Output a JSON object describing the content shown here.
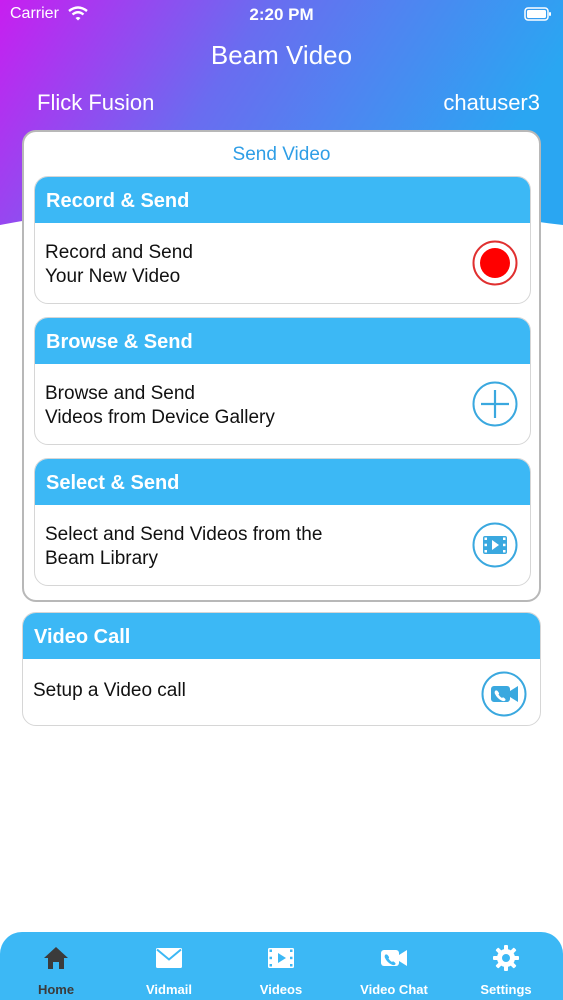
{
  "status_bar": {
    "carrier": "Carrier",
    "time": "2:20 PM"
  },
  "header": {
    "title": "Beam Video",
    "organization": "Flick Fusion",
    "username": "chatuser3"
  },
  "send_panel": {
    "title": "Send Video",
    "cards": [
      {
        "heading": "Record & Send",
        "line1": "Record and Send",
        "line2": "Your New Video",
        "icon": "record-icon"
      },
      {
        "heading": "Browse & Send",
        "line1": "Browse and Send",
        "line2": "Videos from Device Gallery",
        "icon": "plus-icon"
      },
      {
        "heading": "Select & Send",
        "line1": "Select and Send Videos from the",
        "line2": "Beam Library",
        "icon": "film-icon"
      }
    ]
  },
  "video_call": {
    "heading": "Video Call",
    "text": "Setup a Video call",
    "icon": "video-camera-icon"
  },
  "tab_bar": {
    "active": "Home",
    "tabs": [
      {
        "label": "Home",
        "icon": "home-icon"
      },
      {
        "label": "Vidmail",
        "icon": "mail-icon"
      },
      {
        "label": "Videos",
        "icon": "film-icon"
      },
      {
        "label": "Video Chat",
        "icon": "video-camera-icon"
      },
      {
        "label": "Settings",
        "icon": "gear-icon"
      }
    ]
  },
  "colors": {
    "gradient_start": "#c81ef0",
    "gradient_mid": "#6a6cf0",
    "gradient_end": "#2aa6f2",
    "accent": "#3cb8f5",
    "record_red": "#ff0000",
    "panel_title": "#2f9ee6"
  }
}
